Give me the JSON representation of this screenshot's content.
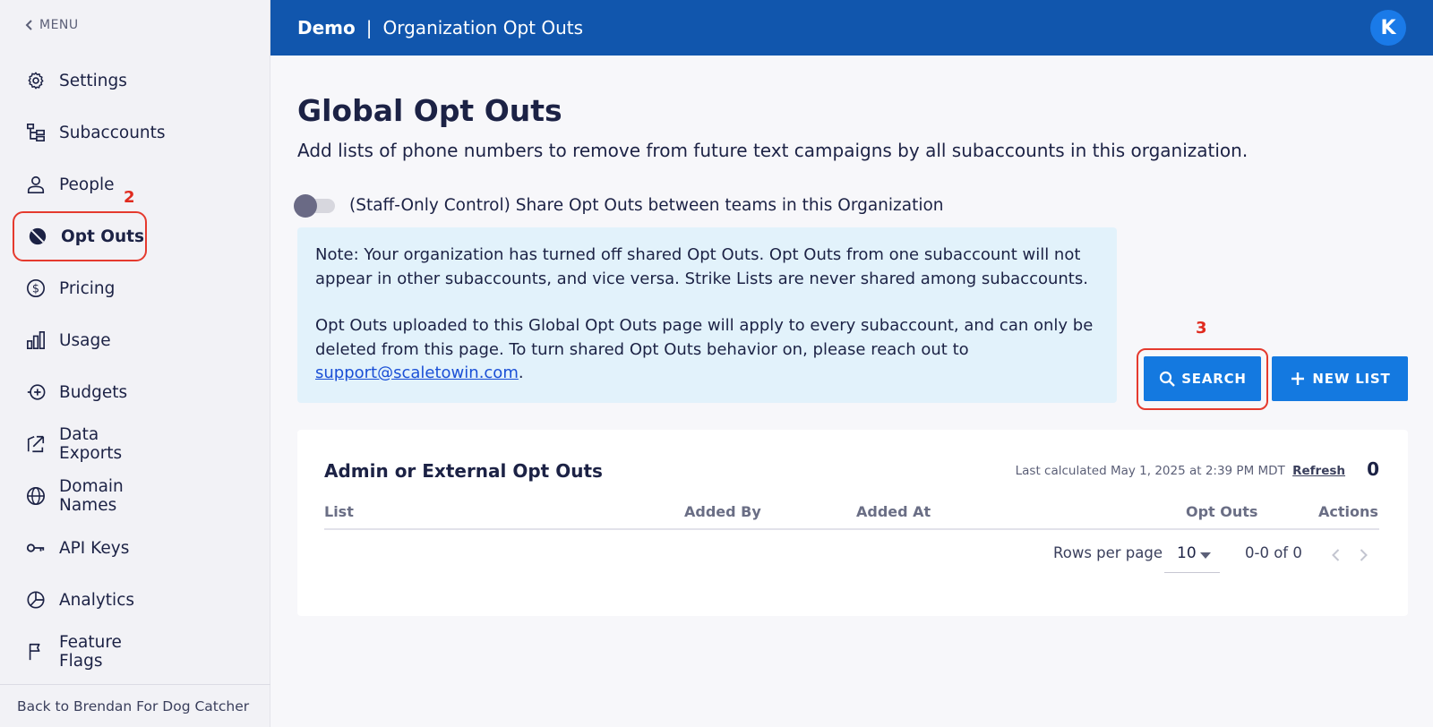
{
  "sidebar": {
    "menu_label": "MENU",
    "items": [
      {
        "label": "Settings",
        "icon": "gear-icon"
      },
      {
        "label": "Subaccounts",
        "icon": "hierarchy-icon"
      },
      {
        "label": "People",
        "icon": "person-icon"
      },
      {
        "label": "Opt Outs",
        "icon": "block-icon",
        "active": true
      },
      {
        "label": "Pricing",
        "icon": "dollar-icon"
      },
      {
        "label": "Usage",
        "icon": "bar-chart-icon"
      },
      {
        "label": "Budgets",
        "icon": "budget-icon"
      },
      {
        "label": "Data Exports",
        "icon": "export-icon"
      },
      {
        "label": "Domain Names",
        "icon": "globe-icon"
      },
      {
        "label": "API Keys",
        "icon": "key-icon"
      },
      {
        "label": "Analytics",
        "icon": "pie-chart-icon"
      },
      {
        "label": "Feature Flags",
        "icon": "flag-icon"
      }
    ],
    "footer_label": "Back to Brendan For Dog Catcher"
  },
  "annotations": {
    "step2": "2",
    "step3": "3"
  },
  "header": {
    "org": "Demo",
    "separator": "|",
    "page": "Organization Opt Outs",
    "avatar_initial": "K"
  },
  "main": {
    "title": "Global Opt Outs",
    "subtitle": "Add lists of phone numbers to remove from future text campaigns by all subaccounts in this organization.",
    "toggle_label": "(Staff-Only Control) Share Opt Outs between teams in this Organization",
    "toggle_on": false,
    "note_p1": "Note: Your organization has turned off shared Opt Outs. Opt Outs from one subaccount will not appear in other subaccounts, and vice versa. Strike Lists are never shared among subaccounts.",
    "note_p2": "Opt Outs uploaded to this Global Opt Outs page will apply to every subaccount, and can only be deleted from this page. To turn shared Opt Outs behavior on, please reach out to",
    "note_email": "support@scaletowin.com",
    "note_end": ".",
    "search_label": "SEARCH",
    "new_list_label": "NEW LIST"
  },
  "card": {
    "title": "Admin or External Opt Outs",
    "last_calculated": "Last calculated May 1, 2025 at 2:39 PM MDT",
    "refresh_label": "Refresh",
    "total": "0",
    "columns": [
      "List",
      "Added By",
      "Added At",
      "Opt Outs",
      "Actions"
    ],
    "rows_per_page_label": "Rows per page",
    "rows_per_page": "10",
    "range": "0-0 of 0"
  },
  "colors": {
    "header_bg": "#1156ad",
    "accent": "#1479e0",
    "annotation": "#e53a2e",
    "note_bg": "#e2f2fb"
  }
}
